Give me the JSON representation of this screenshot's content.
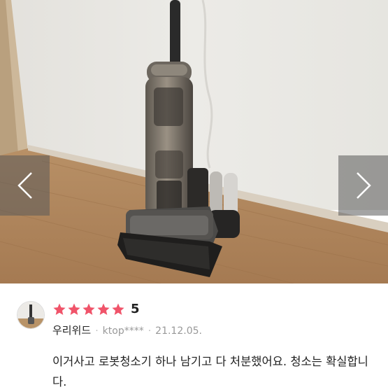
{
  "gallery": {
    "prev_icon": "chevron-left-icon",
    "next_icon": "chevron-right-icon"
  },
  "review": {
    "stars": 5,
    "rating_label": "5",
    "author": "우리위드",
    "buyer": "ktop****",
    "date": "21.12.05.",
    "text": "이거사고 로봇청소기 하나 남기고 다 처분했어요. 청소는 확실합니다.",
    "star_color": "#f0546a"
  }
}
